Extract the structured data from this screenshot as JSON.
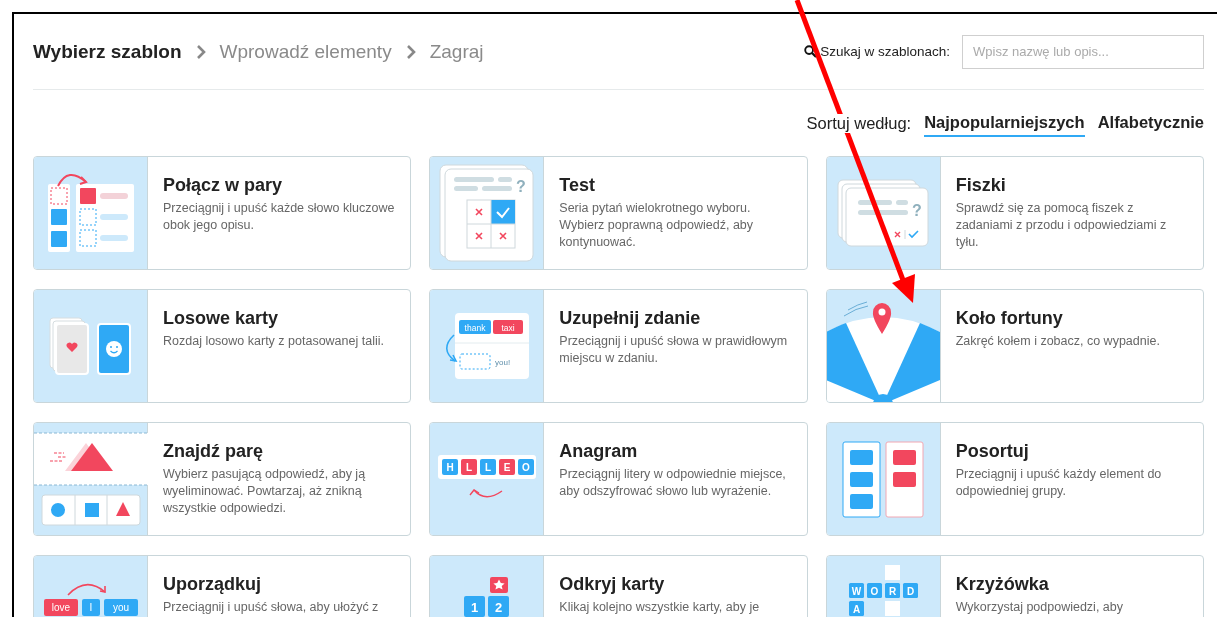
{
  "breadcrumb": [
    {
      "label": "Wybierz szablon",
      "selected": true
    },
    {
      "label": "Wprowadź elementy",
      "selected": false
    },
    {
      "label": "Zagraj",
      "selected": false
    }
  ],
  "search": {
    "label": "Szukaj w szablonach:",
    "placeholder": "Wpisz nazwę lub opis..."
  },
  "sort": {
    "label": "Sortuj według:",
    "options": [
      {
        "label": "Najpopularniejszych",
        "selected": true
      },
      {
        "label": "Alfabetycznie",
        "selected": false
      }
    ]
  },
  "templates": [
    {
      "kind": "match",
      "title": "Połącz w pary",
      "description": "Przeciągnij i upuść każde słowo kluczowe obok jego opisu."
    },
    {
      "kind": "test",
      "title": "Test",
      "description": "Seria pytań wielokrotnego wyboru. Wybierz poprawną odpowiedź, aby kontynuować.",
      "labels": [
        "?"
      ]
    },
    {
      "kind": "flashcards",
      "title": "Fiszki",
      "description": "Sprawdź się za pomocą fiszek z zadaniami z przodu i odpowiedziami z tyłu.",
      "labels": [
        "?"
      ]
    },
    {
      "kind": "cards",
      "title": "Losowe karty",
      "description": "Rozdaj losowo karty z potasowanej talii."
    },
    {
      "kind": "fill",
      "title": "Uzupełnij zdanie",
      "description": "Przeciągnij i upuść słowa w prawidłowym miejscu w zdaniu.",
      "labels": [
        "thank",
        "taxi",
        "you!"
      ]
    },
    {
      "kind": "wheel",
      "title": "Koło fortuny",
      "description": "Zakręć kołem i zobacz, co wypadnie."
    },
    {
      "kind": "findpair",
      "title": "Znajdź parę",
      "description": "Wybierz pasującą odpowiedź, aby ją wyeliminować. Powtarzaj, aż znikną wszystkie odpowiedzi."
    },
    {
      "kind": "anagram",
      "title": "Anagram",
      "description": "Przeciągnij litery w odpowiednie miejsce, aby odszyfrować słowo lub wyrażenie.",
      "labels": [
        "H",
        "L",
        "L",
        "E",
        "O"
      ]
    },
    {
      "kind": "sort",
      "title": "Posortuj",
      "description": "Przeciągnij i upuść każdy element do odpowiedniej grupy."
    },
    {
      "kind": "order",
      "title": "Uporządkuj",
      "description": "Przeciągnij i upuść słowa, aby ułożyć z",
      "labels": [
        "love",
        "I",
        "you"
      ]
    },
    {
      "kind": "reveal",
      "title": "Odkryj karty",
      "description": "Klikaj kolejno wszystkie karty, aby je",
      "labels": [
        "1",
        "2"
      ]
    },
    {
      "kind": "crossword",
      "title": "Krzyżówka",
      "description": "Wykorzystaj podpowiedzi, aby",
      "labels": [
        "W",
        "O",
        "R",
        "D",
        "A"
      ]
    }
  ]
}
